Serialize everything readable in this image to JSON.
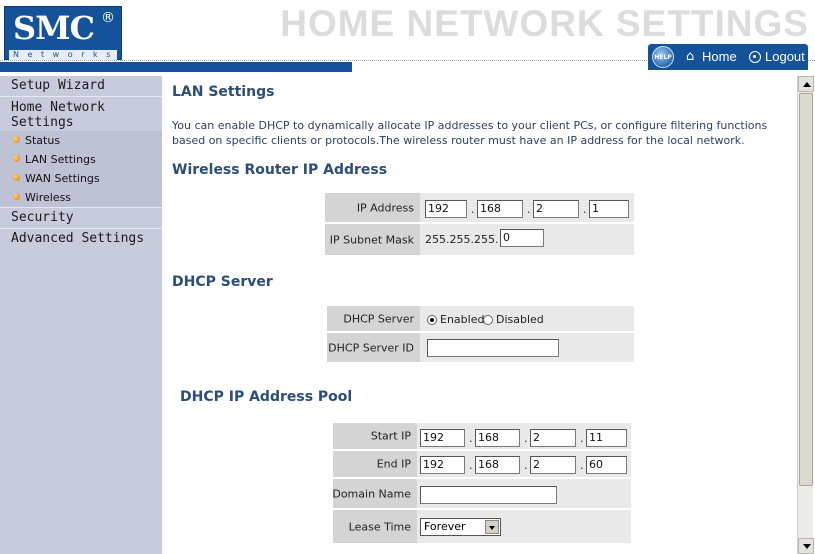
{
  "brand": {
    "logo_text": "SMC",
    "logo_reg": "®",
    "logo_subtitle": "N e t w o r k s"
  },
  "header": {
    "title": "HOME NETWORK SETTINGS",
    "help_label": "HELP",
    "home_label": "Home",
    "logout_label": "Logout"
  },
  "sidebar": {
    "setup_wizard": "Setup Wizard",
    "home_network_settings": "Home Network Settings",
    "sub_items": [
      "Status",
      "LAN Settings",
      "WAN Settings",
      "Wireless"
    ],
    "security": "Security",
    "advanced_settings": "Advanced Settings"
  },
  "content": {
    "title": "LAN Settings",
    "intro": "You can enable DHCP to dynamically allocate IP addresses to your client PCs, or configure filtering functions based on specific clients or protocols.The wireless router must have an IP address for the local network.",
    "router_section": {
      "title": "Wireless Router IP Address",
      "ip_label": "IP Address",
      "ip": [
        "192",
        "168",
        "2",
        "1"
      ],
      "mask_label": "IP Subnet Mask",
      "mask_prefix": "255.255.255.",
      "mask_last": "0"
    },
    "dhcp_section": {
      "title": "DHCP Server",
      "server_label": "DHCP Server",
      "enabled_label": "Enabled",
      "disabled_label": "Disabled",
      "selected": "Enabled",
      "server_id_label": "DHCP Server ID",
      "server_id": ""
    },
    "pool_section": {
      "title": "DHCP IP Address Pool",
      "start_label": "Start IP",
      "start_ip": [
        "192",
        "168",
        "2",
        "11"
      ],
      "end_label": "End IP",
      "end_ip": [
        "192",
        "168",
        "2",
        "60"
      ],
      "domain_label": "Domain Name",
      "domain": "",
      "lease_label": "Lease Time",
      "lease": "Forever"
    },
    "ip_separator": "."
  },
  "colors": {
    "brand_blue": "#14539a",
    "sidebar_bg": "#c8cbdb",
    "heading": "#2c4d7a"
  }
}
